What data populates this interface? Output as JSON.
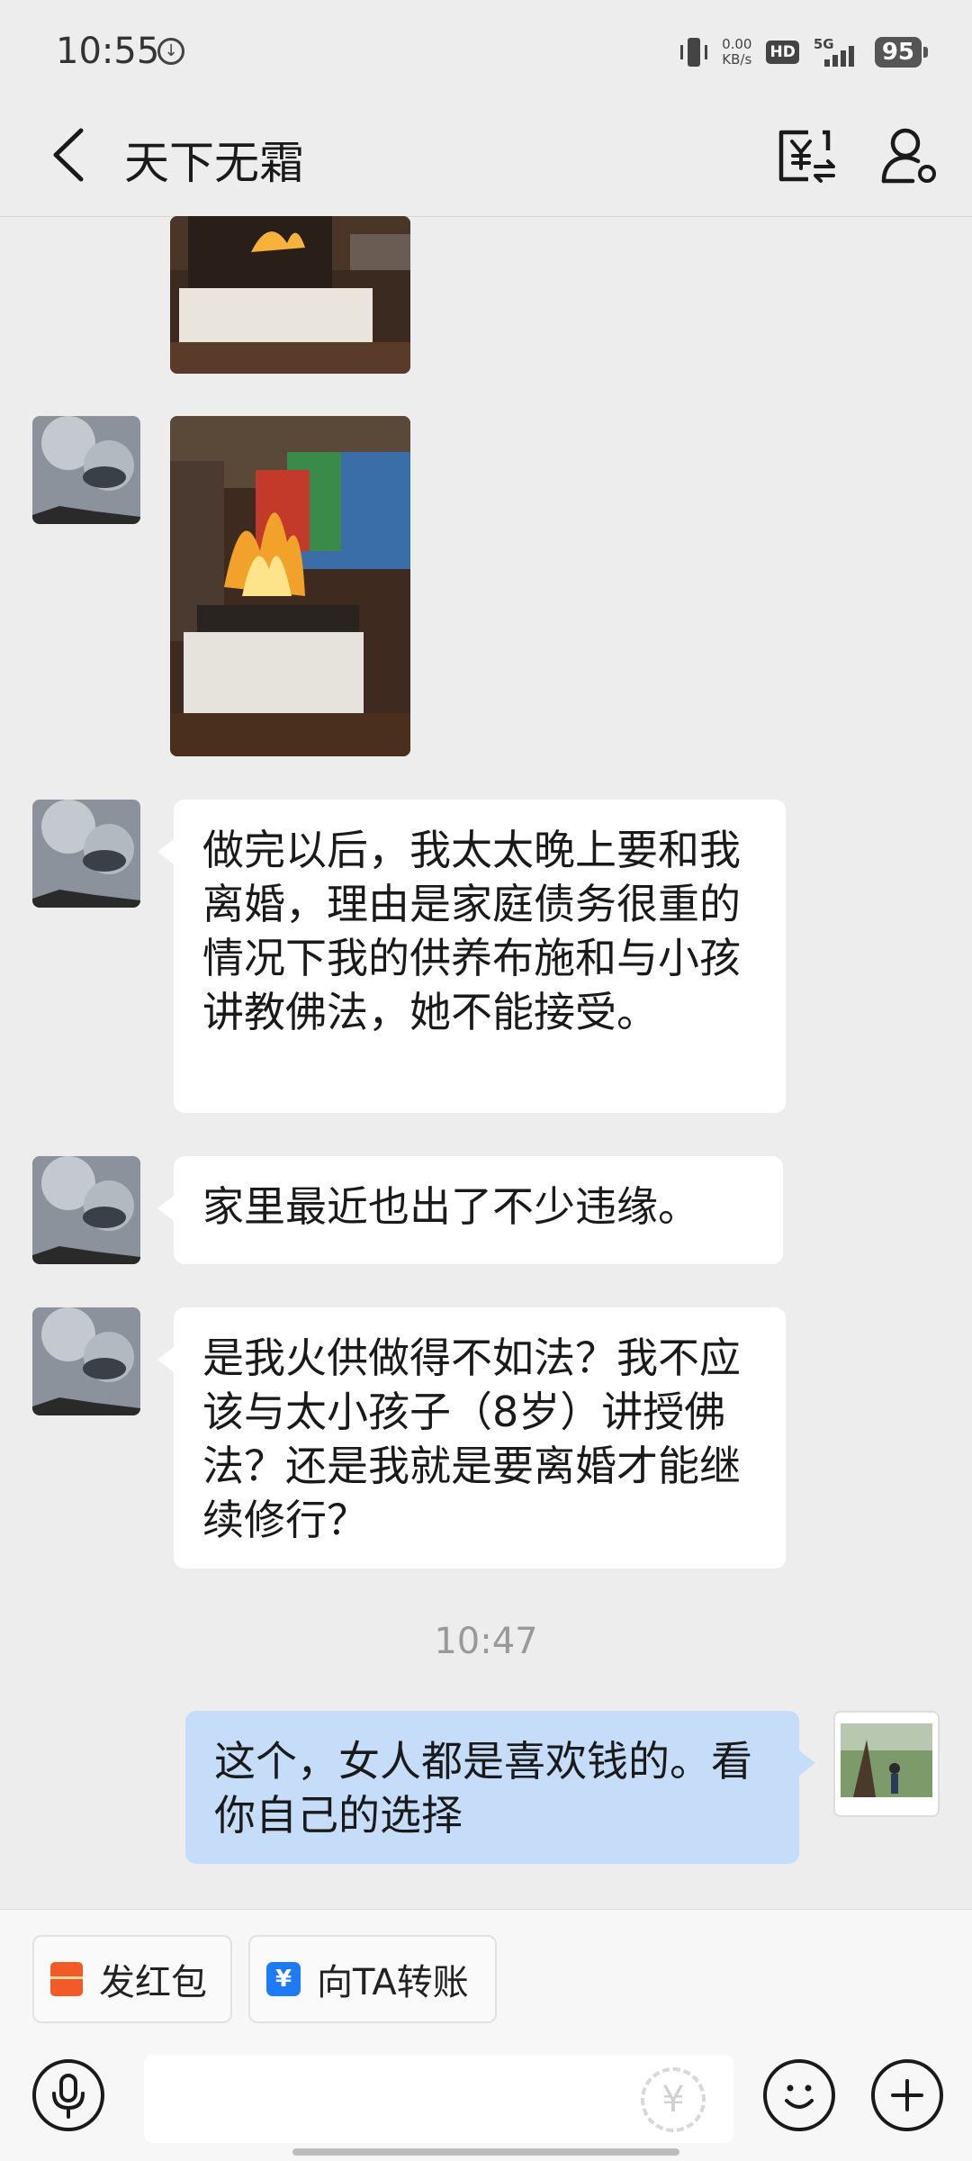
{
  "status_bar": {
    "time": "10:55",
    "network_speed": "0.00",
    "network_unit": "KB/s",
    "hd": "HD",
    "signal": "5G",
    "battery": "95"
  },
  "header": {
    "title": "天下无霜"
  },
  "messages": [
    {
      "sender": "other",
      "type": "image"
    },
    {
      "sender": "other",
      "type": "image"
    },
    {
      "sender": "other",
      "type": "text",
      "text": "做完以后，我太太晚上要和我离婚，理由是家庭债务很重的情况下我的供养布施和与小孩讲教佛法，她不能接受。"
    },
    {
      "sender": "other",
      "type": "text",
      "text": "家里最近也出了不少违缘。"
    },
    {
      "sender": "other",
      "type": "text",
      "text": "是我火供做得不如法？我不应该与太小孩子（8岁）讲授佛法？还是我就是要离婚才能继续修行？"
    },
    {
      "sender": "me",
      "type": "text",
      "text": "这个，女人都是喜欢钱的。看你自己的选择"
    }
  ],
  "timestamp": "10:47",
  "quick_actions": [
    {
      "label": "发红包",
      "icon": "red-packet-icon",
      "color": "#f25a27"
    },
    {
      "label": "向TA转账",
      "icon": "transfer-icon",
      "color": "#1e7bf5"
    }
  ],
  "input": {
    "value": "",
    "placeholder": ""
  },
  "colors": {
    "background": "#ededed",
    "incoming_bubble": "#ffffff",
    "outgoing_bubble": "#c5ddf8"
  }
}
